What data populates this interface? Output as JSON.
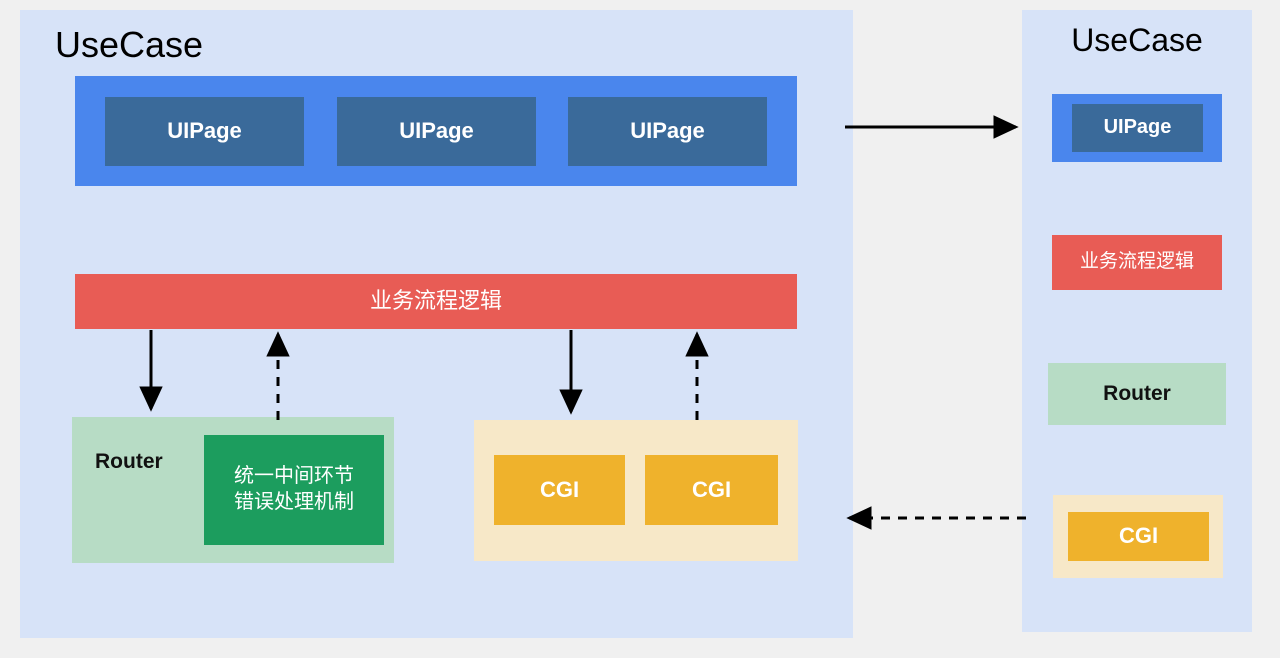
{
  "page": {
    "background_color": "#f0f0f0"
  },
  "left_panel": {
    "title": "UseCase",
    "background_color": "#d7e3f8",
    "ui_band": {
      "color": "#4a86ed",
      "pages": [
        {
          "label": "UIPage"
        },
        {
          "label": "UIPage"
        },
        {
          "label": "UIPage"
        }
      ]
    },
    "business_bar": {
      "label": "业务流程逻辑",
      "color": "#e85c55"
    },
    "router_group": {
      "color": "#b7dcc5",
      "label": "Router",
      "middleware": {
        "line1": "统一中间环节",
        "line2": "错误处理机制",
        "color": "#1c9d5e"
      }
    },
    "cgi_group": {
      "color": "#f7e8c8",
      "items": [
        {
          "label": "CGI",
          "color": "#efb22c"
        },
        {
          "label": "CGI",
          "color": "#efb22c"
        }
      ]
    }
  },
  "right_panel": {
    "title": "UseCase",
    "background_color": "#d7e3f8",
    "ui_band": {
      "color": "#4a86ed",
      "page_label": "UIPage"
    },
    "business_chip": {
      "label": "业务流程逻辑",
      "color": "#e85c55"
    },
    "router_chip": {
      "label": "Router",
      "color": "#b7dcc5"
    },
    "cgi_group": {
      "color": "#f7e8c8",
      "item_label": "CGI",
      "item_color": "#efb22c"
    }
  },
  "connectors": {
    "color": "#000000",
    "panel_top": {
      "style": "solid",
      "direction": "right"
    },
    "panel_bottom": {
      "style": "dashed",
      "direction": "left"
    },
    "business_to_router": {
      "style": "solid",
      "direction": "down"
    },
    "router_to_business": {
      "style": "dashed",
      "direction": "up"
    },
    "business_to_cgi": {
      "style": "solid",
      "direction": "down"
    },
    "cgi_to_business": {
      "style": "dashed",
      "direction": "up"
    }
  }
}
